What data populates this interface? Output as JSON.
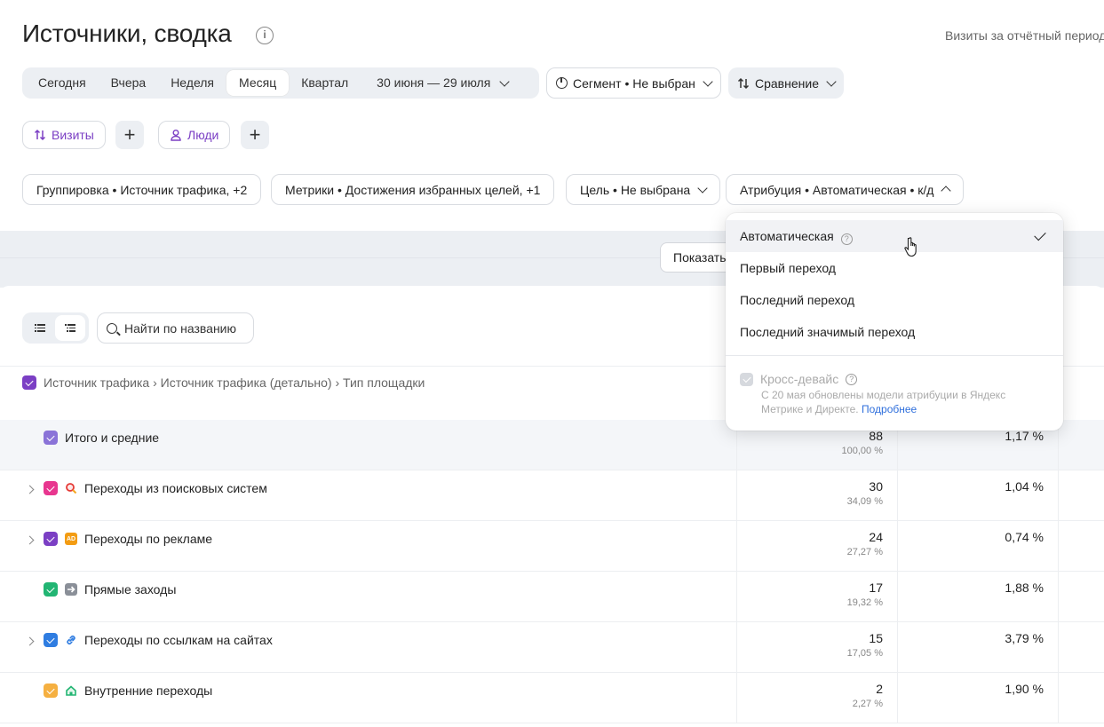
{
  "header": {
    "title": "Источники, сводка",
    "top_right": "Визиты за отчётный период"
  },
  "periods": {
    "items": [
      "Сегодня",
      "Вчера",
      "Неделя",
      "Месяц",
      "Квартал"
    ],
    "active": "Месяц",
    "range": "30 июня — 29 июля"
  },
  "segment": {
    "label": "Сегмент • Не выбран"
  },
  "compare": {
    "label": "Сравнение"
  },
  "metric_pills": {
    "visits": "Визиты",
    "people": "Люди"
  },
  "filters": {
    "grouping": "Группировка • Источник трафика, +2",
    "metrics": "Метрики • Достижения избранных целей, +1",
    "goal": "Цель • Не выбрана",
    "attribution": "Атрибуция • Автоматическая • к/д"
  },
  "show_button": {
    "label": "Показать"
  },
  "search": {
    "placeholder": "Найти по названию"
  },
  "dimension_path": "Источник трафика › Источник трафика (детально) › Тип площадки",
  "rows": [
    {
      "name": "Итого и средние",
      "value": "88",
      "share": "100,00 %",
      "rate": "1,17 %",
      "checkbox_color": "#8a73d8",
      "icon": "",
      "expandable": false,
      "total": true
    },
    {
      "name": "Переходы из поисковых систем",
      "value": "30",
      "share": "34,09 %",
      "rate": "1,04 %",
      "checkbox_color": "#e8368f",
      "icon": "search-icon",
      "expandable": true
    },
    {
      "name": "Переходы по рекламе",
      "value": "24",
      "share": "27,27 %",
      "rate": "0,74 %",
      "checkbox_color": "#7b3fc4",
      "icon": "ad-icon",
      "expandable": true
    },
    {
      "name": "Прямые заходы",
      "value": "17",
      "share": "19,32 %",
      "rate": "1,88 %",
      "checkbox_color": "#22b573",
      "icon": "arrow-right-icon",
      "expandable": false
    },
    {
      "name": "Переходы по ссылкам на сайтах",
      "value": "15",
      "share": "17,05 %",
      "rate": "3,79 %",
      "checkbox_color": "#2f7de1",
      "icon": "link-icon",
      "expandable": true
    },
    {
      "name": "Внутренние переходы",
      "value": "2",
      "share": "2,27 %",
      "rate": "1,90 %",
      "checkbox_color": "#f5b041",
      "icon": "home-icon",
      "expandable": false
    }
  ],
  "dropdown": {
    "options": [
      "Автоматическая",
      "Первый переход",
      "Последний переход",
      "Последний значимый переход"
    ],
    "selected": "Автоматическая",
    "cross_device": {
      "label": "Кросс-девайс",
      "note": "С 20 мая обновлены модели атрибуции в Яндекс Метрике и Директе.",
      "link": "Подробнее"
    }
  },
  "colors": {
    "accent_purple": "#7b3fc4",
    "link_blue": "#2f6fdc",
    "gray_bg": "#eceff3"
  }
}
